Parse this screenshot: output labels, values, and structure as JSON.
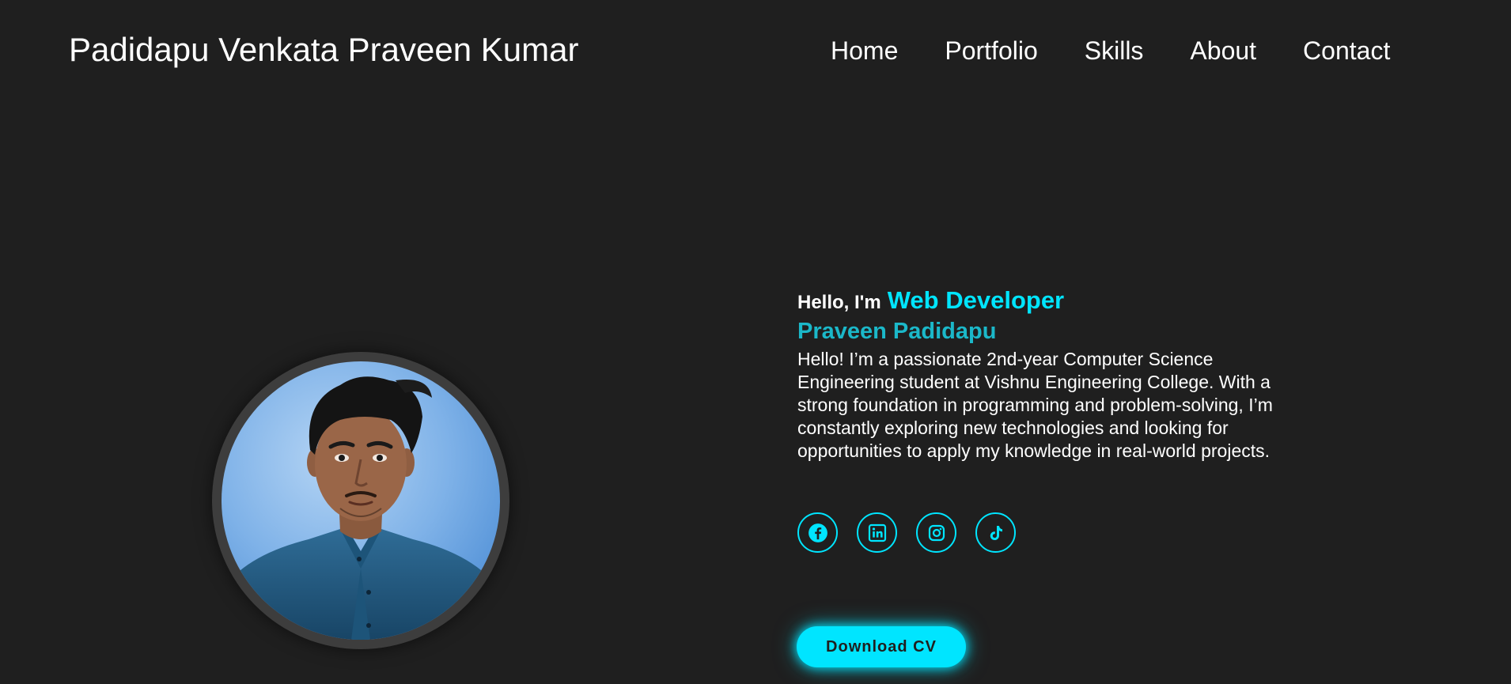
{
  "header": {
    "logo_text": "Padidapu Venkata Praveen Kumar",
    "nav": [
      {
        "label": "Home"
      },
      {
        "label": "Portfolio"
      },
      {
        "label": "Skills"
      },
      {
        "label": "About"
      },
      {
        "label": "Contact"
      }
    ]
  },
  "hero": {
    "greeting": "Hello, I'm",
    "role": "Web Developer",
    "name": "Praveen Padidapu",
    "bio": "Hello! I’m a passionate 2nd-year Computer Science Engineering student at Vishnu Engineering College. With a strong foundation in programming and problem-solving, I’m constantly exploring new technologies and looking for opportunities to apply my knowledge in real-world projects.",
    "socials": [
      {
        "icon": "facebook-icon"
      },
      {
        "icon": "linkedin-icon"
      },
      {
        "icon": "instagram-icon"
      },
      {
        "icon": "tiktok-icon"
      }
    ],
    "cv_button_label": "Download CV"
  },
  "colors": {
    "background": "#1f1f1f",
    "accent": "#00e5ff",
    "name_accent": "#1bb8c9",
    "text": "#ffffff"
  }
}
